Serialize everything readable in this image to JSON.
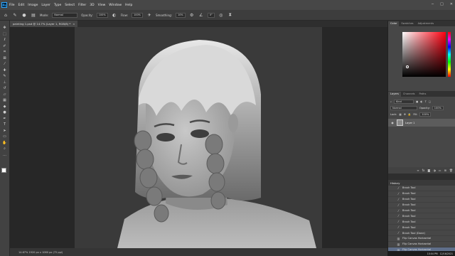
{
  "app": {
    "logo": "Ps",
    "menu": [
      "File",
      "Edit",
      "Image",
      "Layer",
      "Type",
      "Select",
      "Filter",
      "3D",
      "View",
      "Window",
      "Help"
    ],
    "window_controls": [
      "minimize-icon",
      "maximize-icon",
      "close-icon"
    ]
  },
  "options_bar": {
    "mode_label": "Mode:",
    "mode_value": "Normal",
    "opacity_label": "Opacity:",
    "opacity_value": "100%",
    "flow_label": "Flow:",
    "flow_value": "100%",
    "smoothing_label": "Smoothing:",
    "smoothing_value": "10%",
    "angle_value": "0°"
  },
  "document": {
    "tab_title": "painting 1.psd @ 14.7% (Layer 1, RGB/8) *",
    "status_text": "14.67%     1920 px x 1080 px (72 ppi)"
  },
  "panels": {
    "color_tabs": [
      "Color",
      "Swatches",
      "Adjustments"
    ],
    "layers_tabs": [
      "Layers",
      "Channels",
      "Paths"
    ],
    "layers": {
      "kind_filter": "Kind",
      "blend_mode": "Normal",
      "opacity_label": "Opacity:",
      "opacity_value": "100%",
      "lock_label": "Lock:",
      "fill_label": "Fill:",
      "fill_value": "100%",
      "items": [
        {
          "name": "Layer 1"
        }
      ]
    },
    "history": {
      "title": "History",
      "items": [
        "Brush Tool",
        "Brush Tool",
        "Brush Tool",
        "Brush Tool",
        "Brush Tool",
        "Brush Tool",
        "Brush Tool",
        "Brush Tool",
        "Brush Tool (Done)",
        "Flip Canvas Horizontal",
        "Flip Canvas Horizontal",
        "Flip Canvas Horizontal"
      ]
    }
  },
  "taskbar": {
    "time": "10:04 PM",
    "date": "12/16/2021"
  },
  "colors": {
    "accent_active": "#5f6f8a",
    "foreground": "#ffffff",
    "background": "#111111"
  }
}
